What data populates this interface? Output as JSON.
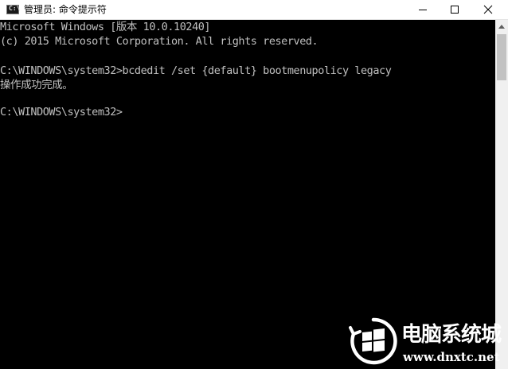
{
  "window": {
    "title": "管理员: 命令提示符",
    "icon": "cmd-icon",
    "icon_glyph": "C:\\",
    "controls": {
      "minimize_icon": "minimize-icon",
      "maximize_icon": "maximize-icon",
      "close_icon": "close-icon"
    }
  },
  "console": {
    "lines": [
      "Microsoft Windows [版本 10.0.10240]",
      "(c) 2015 Microsoft Corporation. All rights reserved.",
      "",
      "C:\\WINDOWS\\system32>bcdedit /set {default} bootmenupolicy legacy",
      "操作成功完成。",
      "",
      "C:\\WINDOWS\\system32>"
    ],
    "colors": {
      "background": "#000000",
      "text": "#c0c0c0"
    }
  },
  "scrollbar": {
    "up_icon": "scroll-up-arrow-icon"
  },
  "watermark": {
    "title": "电脑系统城",
    "url": "www.dnxtc.net",
    "logo_icon": "windows-logo-icon"
  }
}
